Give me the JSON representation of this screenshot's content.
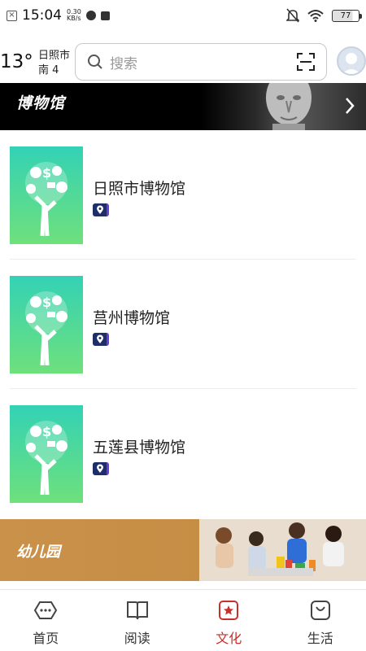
{
  "status_bar": {
    "time": "15:04",
    "speed_value": "0.30",
    "speed_unit": "KB/s",
    "battery": "77"
  },
  "header": {
    "temperature": "13°",
    "city": "日照市",
    "wind": "南 4",
    "search_placeholder": "搜索"
  },
  "museum_banner": {
    "title": "博物馆"
  },
  "museums": [
    {
      "name": "日照市博物馆"
    },
    {
      "name": "莒州博物馆"
    },
    {
      "name": "五莲县博物馆"
    }
  ],
  "kindergarten_banner": {
    "title": "幼儿园"
  },
  "bottom_nav": [
    {
      "label": "首页",
      "icon": "home-icon"
    },
    {
      "label": "阅读",
      "icon": "book-icon"
    },
    {
      "label": "文化",
      "icon": "culture-icon",
      "active": true
    },
    {
      "label": "生活",
      "icon": "life-icon"
    }
  ],
  "colors": {
    "accent": "#c9302c",
    "thumb_top": "#33d2b5",
    "thumb_bottom": "#6fe07c",
    "kinder_banner": "#c9914a"
  }
}
